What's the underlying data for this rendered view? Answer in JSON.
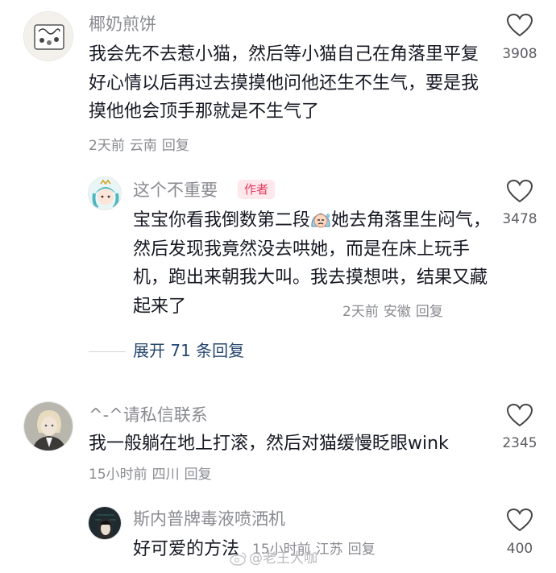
{
  "comments": [
    {
      "username": "椰奶煎饼",
      "text": "我会先不去惹小猫，然后等小猫自己在角落里平复好心情以后再过去摸摸他问他还生不生气，要是我摸他他会顶手那就是不生气了",
      "time": "2天前",
      "location": "云南",
      "reply_label": "回复",
      "likes": "3908",
      "replies": [
        {
          "username": "这个不重要",
          "badge": "作者",
          "text_before_emoji": "宝宝你看我倒数第二段",
          "emoji": "sweating-face-emoji",
          "text_after_emoji": "她去角落里生闷气，然后发现我竟然没去哄她，而是在床上玩手机，跑出来朝我大叫。我去摸想哄，结果又藏起来了",
          "time": "2天前",
          "location": "安徽",
          "reply_label": "回复",
          "likes": "3478"
        }
      ],
      "expand_label": "展开 71 条回复"
    },
    {
      "username": "^-^请私信联系",
      "text": "我一般躺在地上打滚，然后对猫缓慢眨眼wink",
      "time": "15小时前",
      "location": "四川",
      "reply_label": "回复",
      "likes": "2345",
      "replies": [
        {
          "username": "斯内普牌毒液喷洒机",
          "text": "好可爱的方法",
          "time": "15小时前",
          "location": "江苏",
          "reply_label": "回复",
          "likes": "400"
        }
      ]
    }
  ],
  "watermark": "@老王大咖",
  "icons": {
    "like": "heart-outline-icon",
    "watermark": "weibo-logo-icon"
  },
  "colors": {
    "author_badge_bg": "#fde8ec",
    "author_badge_text": "#e33a5d",
    "expand_link": "#25466e",
    "meta": "#8a8b91"
  }
}
